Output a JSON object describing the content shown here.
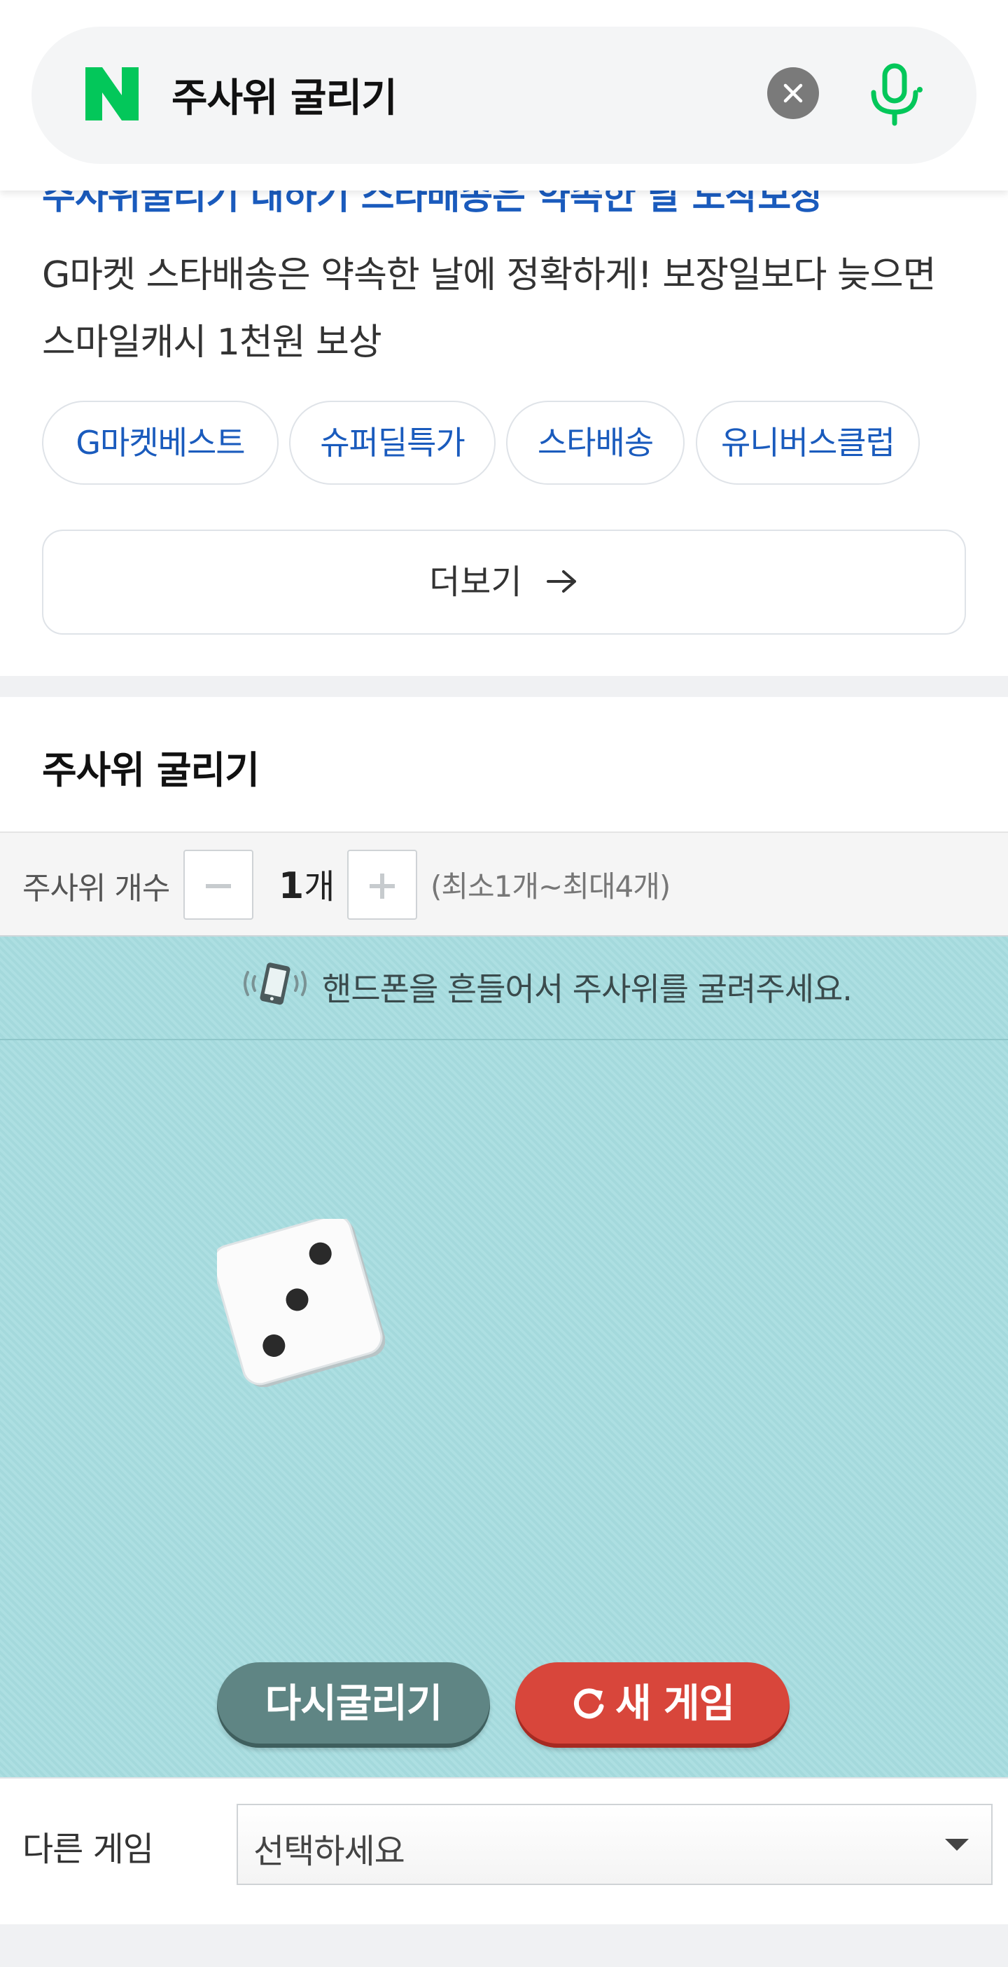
{
  "search": {
    "query": "주사위 굴리기",
    "logo_letter": "N",
    "brand_color": "#03c75a"
  },
  "ad": {
    "headline_cut": "주사위굴리기 대하기 스타배송은 약속한 날 도착보장",
    "description": "G마켓 스타배송은 약속한 날에 정확하게! 보장일보다 늦으면 스마일캐시 1천원 보상",
    "chips": [
      "G마켓베스트",
      "슈퍼딜특가",
      "스타배송",
      "유니버스클럽"
    ],
    "more_label": "더보기",
    "link_color": "#1a5bbd"
  },
  "widget": {
    "title": "주사위 굴리기",
    "count_label": "주사위 개수",
    "count_value": "1",
    "count_unit": "개",
    "count_hint": "(최소1개~최대4개)",
    "shake_hint": "핸드폰을 흔들어서 주사위를 굴려주세요.",
    "dice_face": 3,
    "reroll_label": "다시굴리기",
    "new_game_label": "새 게임",
    "board_color": "#a7dde0"
  },
  "other_game": {
    "label": "다른 게임",
    "select_value": "선택하세요"
  }
}
